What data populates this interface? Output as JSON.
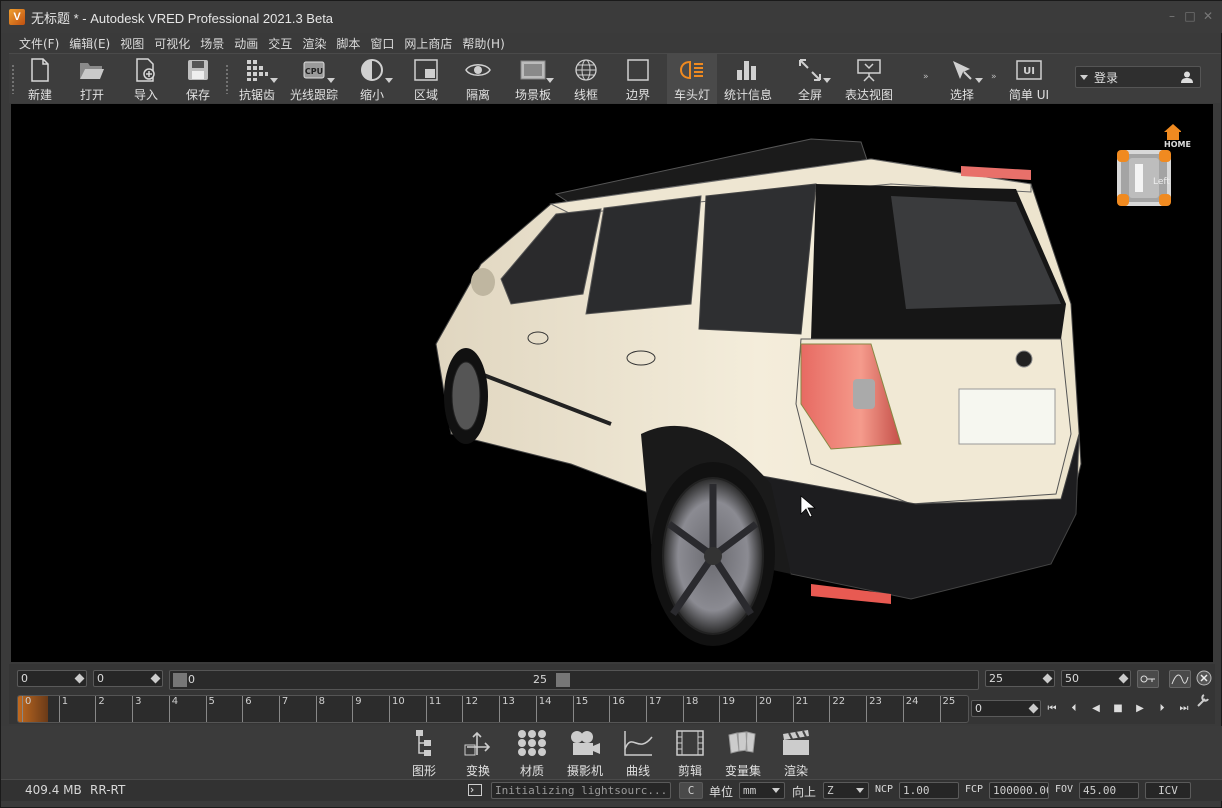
{
  "window": {
    "title": "无标题 * - Autodesk VRED Professional 2021.3 Beta",
    "logo_letter": "V"
  },
  "menu": [
    "文件(F)",
    "编辑(E)",
    "视图",
    "可视化",
    "场景",
    "动画",
    "交互",
    "渲染",
    "脚本",
    "窗口",
    "网上商店",
    "帮助(H)"
  ],
  "toolbar": {
    "tools": [
      {
        "label": "新建",
        "icon": "new-file-icon"
      },
      {
        "label": "打开",
        "icon": "open-folder-icon"
      },
      {
        "label": "导入",
        "icon": "import-icon"
      },
      {
        "label": "保存",
        "icon": "save-icon"
      },
      {
        "label": "抗锯齿",
        "icon": "antialiasing-icon"
      },
      {
        "label": "光线跟踪",
        "icon": "raytracing-icon"
      },
      {
        "label": "缩小",
        "icon": "downscale-icon"
      },
      {
        "label": "区域",
        "icon": "region-icon"
      },
      {
        "label": "隔离",
        "icon": "isolate-icon"
      },
      {
        "label": "场景板",
        "icon": "sceneplate-icon"
      },
      {
        "label": "线框",
        "icon": "wireframe-icon"
      },
      {
        "label": "边界",
        "icon": "bounding-box-icon"
      },
      {
        "label": "车头灯",
        "icon": "headlight-icon"
      },
      {
        "label": "统计信息",
        "icon": "statistics-icon"
      },
      {
        "label": "全屏",
        "icon": "fullscreen-icon"
      },
      {
        "label": "表达视图",
        "icon": "presentation-icon"
      },
      {
        "label": "选择",
        "icon": "select-icon"
      },
      {
        "label": "简单 UI",
        "icon": "simple-ui-icon"
      }
    ],
    "login_label": "登录",
    "cpu_chip_text": "CPU",
    "simple_ui_badge": "UI"
  },
  "viewport": {
    "navcube_home": "HOME",
    "navcube_face": "Left"
  },
  "timeline": {
    "start_a": "0",
    "start_b": "0",
    "range_start": "0",
    "range_end": "25",
    "end_a": "25",
    "end_b": "50",
    "current_frame": "0",
    "ticks": [
      "0",
      "1",
      "2",
      "3",
      "4",
      "5",
      "6",
      "7",
      "8",
      "9",
      "10",
      "11",
      "12",
      "13",
      "14",
      "15",
      "16",
      "17",
      "18",
      "19",
      "20",
      "21",
      "22",
      "23",
      "24",
      "25"
    ]
  },
  "modules": [
    {
      "label": "图形",
      "icon": "scenegraph-icon"
    },
    {
      "label": "变换",
      "icon": "transform-icon"
    },
    {
      "label": "材质",
      "icon": "materials-icon"
    },
    {
      "label": "摄影机",
      "icon": "camera-icon"
    },
    {
      "label": "曲线",
      "icon": "curves-icon"
    },
    {
      "label": "剪辑",
      "icon": "clips-icon"
    },
    {
      "label": "变量集",
      "icon": "variant-sets-icon"
    },
    {
      "label": "渲染",
      "icon": "render-icon"
    }
  ],
  "status": {
    "memory": "409.4 MB",
    "render_mode": "RR-RT",
    "message": "Initializing lightsourc...",
    "c_button": "C",
    "unit_label": "单位",
    "unit_value": "mm",
    "up_label": "向上",
    "up_value": "Z",
    "ncp_label": "NCP",
    "ncp_value": "1.00",
    "fcp_label": "FCP",
    "fcp_value": "100000.00",
    "fov_label": "FOV",
    "fov_value": "45.00",
    "icv_label": "ICV"
  },
  "colors": {
    "accent_orange": "#f08a20",
    "car_body": "#f2ead6",
    "taillight": "#e8706a"
  }
}
